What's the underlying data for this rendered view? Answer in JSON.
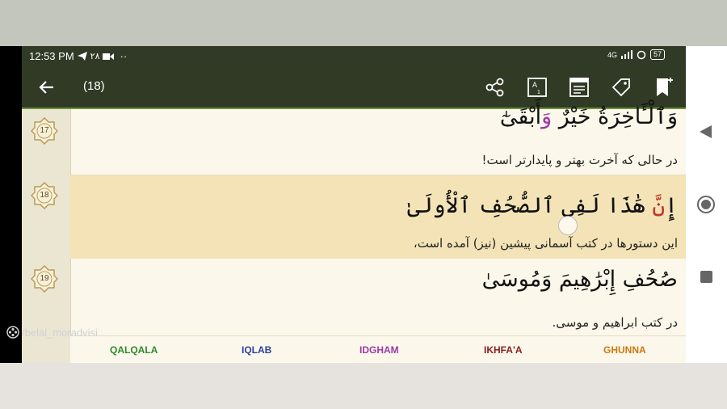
{
  "status_bar": {
    "time": "12:53 PM",
    "notification_count": "٢٨",
    "extra": "··",
    "network": "4G",
    "battery": "57"
  },
  "toolbar": {
    "title": "(18)",
    "icons": [
      "back-arrow-icon",
      "share-icon",
      "font-size-icon",
      "list-icon",
      "tag-icon",
      "bookmark-add-icon"
    ]
  },
  "ayahs": [
    {
      "number": "17",
      "arabic_parts": [
        "وَٱلْـَٔاخِرَةُ خَيْرٌ ",
        "وَ",
        "أَبْقَىٰٓ"
      ],
      "translation": "در حالی که آخرت بهتر و پایدارتر است!"
    },
    {
      "number": "18",
      "arabic_parts": [
        "إِ",
        "نَّ",
        " هَٰذَا لَفِى ٱلصُّحُفِ ٱلْأُولَىٰ"
      ],
      "translation": "این دستورها در کتب آسمانی پیشین (نیز) آمده است،"
    },
    {
      "number": "19",
      "arabic": "صُحُفِ إِبْرَٰهِيمَ وَمُوسَىٰ",
      "translation": "در کتب ابراهیم و موسی."
    }
  ],
  "legend": [
    {
      "label": "QALQALA",
      "color": "#2e8b2e"
    },
    {
      "label": "IQLAB",
      "color": "#2c3fa0"
    },
    {
      "label": "IDGHAM",
      "color": "#9a3aa8"
    },
    {
      "label": "IKHFA'A",
      "color": "#8b1e1e"
    },
    {
      "label": "GHUNNA",
      "color": "#c87a10"
    }
  ],
  "watermark": "/belal_moradvisi",
  "colors": {
    "toolbar": "#303a25",
    "highlight": "#f3e3b6",
    "tajweed_red": "#c0392b",
    "tajweed_purple": "#9a3aa8"
  }
}
